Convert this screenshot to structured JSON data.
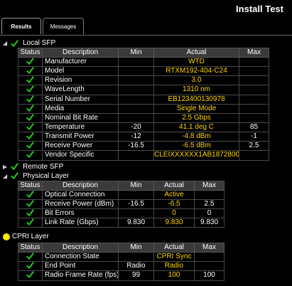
{
  "title": "Install Test",
  "tabs": [
    {
      "label": "Results",
      "active": true
    },
    {
      "label": "Messages",
      "active": false
    }
  ],
  "colors": {
    "check": "#22c522",
    "value": "#ffd400",
    "warning_dot": "#ffea00"
  },
  "sections": {
    "local_sfp": {
      "label": "Local SFP",
      "columns": [
        "Status",
        "Description",
        "Min",
        "Actual",
        "Max"
      ],
      "rows": [
        {
          "desc": "Manufacturer",
          "min": "",
          "actual": "WTD",
          "max": ""
        },
        {
          "desc": "Model",
          "min": "",
          "actual": "RTXM192-404-C24",
          "max": ""
        },
        {
          "desc": "Revision",
          "min": "",
          "actual": "3.0",
          "max": ""
        },
        {
          "desc": "WaveLength",
          "min": "",
          "actual": "1310 nm",
          "max": ""
        },
        {
          "desc": "Serial Number",
          "min": "",
          "actual": "EB123400130978",
          "max": ""
        },
        {
          "desc": "Media",
          "min": "",
          "actual": "Single Mode",
          "max": ""
        },
        {
          "desc": "Nominal Bit Rate",
          "min": "",
          "actual": "2.5 Gbps",
          "max": ""
        },
        {
          "desc": "Temperature",
          "min": "-20",
          "actual": "41.1 deg C",
          "max": "85"
        },
        {
          "desc": "Transmit Power",
          "min": "-12",
          "actual": "-4.8 dBm",
          "max": "-1"
        },
        {
          "desc": "Receive Power",
          "min": "-16.5",
          "actual": "-6.5 dBm",
          "max": "2.5"
        },
        {
          "desc": "Vendor Specific",
          "min": "",
          "actual": "CLEIXXXXXX1AB187280065",
          "max": ""
        }
      ]
    },
    "remote_sfp": {
      "label": "Remote SFP"
    },
    "physical_layer": {
      "label": "Physical Layer",
      "columns": [
        "Status",
        "Description",
        "Min",
        "Actual",
        "Max"
      ],
      "rows": [
        {
          "desc": "Optical Connection",
          "min": "",
          "actual": "Active",
          "max": ""
        },
        {
          "desc": "Receive Power (dBm)",
          "min": "-16.5",
          "actual": "-6.5",
          "max": "2.5"
        },
        {
          "desc": "Bit Errors",
          "min": "",
          "actual": "0",
          "max": "0"
        },
        {
          "desc": "Link Rate (Gbps)",
          "min": "9.830",
          "actual": "9.830",
          "max": "9.830"
        }
      ]
    },
    "cpri_layer": {
      "label": "CPRI Layer",
      "columns": [
        "Status",
        "Description",
        "Min",
        "Actual",
        "Max"
      ],
      "rows": [
        {
          "desc": "Connection State",
          "min": "",
          "actual": "CPRI Sync",
          "max": ""
        },
        {
          "desc": "End Point",
          "min": "Radio",
          "actual": "Radio",
          "max": ""
        },
        {
          "desc": "Radio Frame Rate (fps)",
          "min": "99",
          "actual": "100",
          "max": "100"
        }
      ]
    }
  }
}
